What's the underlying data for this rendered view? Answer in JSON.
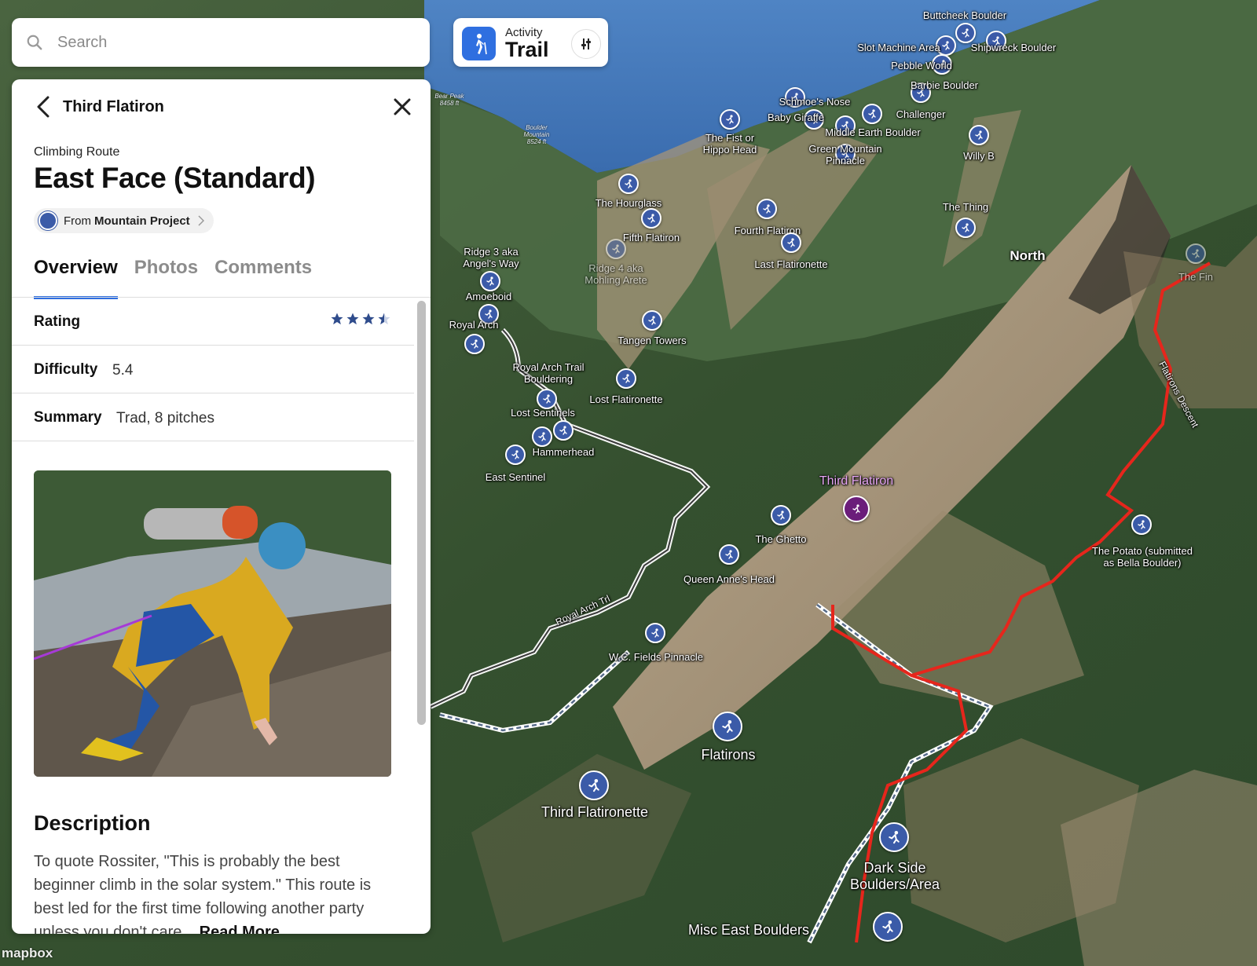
{
  "search": {
    "placeholder": "Search"
  },
  "activity": {
    "label": "Activity",
    "value": "Trail"
  },
  "panel": {
    "header_title": "Third Flatiron",
    "type": "Climbing Route",
    "name": "East Face (Standard)",
    "source_prefix": "From",
    "source_name": "Mountain Project",
    "tabs": [
      "Overview",
      "Photos",
      "Comments"
    ],
    "active_tab": "Overview",
    "rating": {
      "label": "Rating",
      "stars": 3.5,
      "max": 4
    },
    "difficulty": {
      "label": "Difficulty",
      "value": "5.4"
    },
    "summary": {
      "label": "Summary",
      "value": "Trad, 8 pitches"
    },
    "description_heading": "Description",
    "description_text": "To quote Rossiter, \"This is probably the best beginner climb in the solar system.\" This route is best led for the first time following another party unless you don't care...",
    "read_more": "Read More"
  },
  "map": {
    "markers": [
      {
        "label": "Buttcheek Boulder"
      },
      {
        "label": "Slot Machine Area"
      },
      {
        "label": "Shipwreck Boulder"
      },
      {
        "label": "Pebble World"
      },
      {
        "label": "Barbie Boulder"
      },
      {
        "label": "Schmoe's Nose"
      },
      {
        "label": "Baby Giraffe"
      },
      {
        "label": "Challenger"
      },
      {
        "label": "Middle Earth Boulder"
      },
      {
        "label": "The Fist or\nHippo Head"
      },
      {
        "label": "Green Mountain\nPinnacle"
      },
      {
        "label": "Willy B"
      },
      {
        "label": "The Hourglass"
      },
      {
        "label": "Fifth Flatiron"
      },
      {
        "label": "Ridge 4 aka\nMohling Arete"
      },
      {
        "label": "Fourth Flatiron"
      },
      {
        "label": "Last Flatironette"
      },
      {
        "label": "The Thing"
      },
      {
        "label": "Ridge 3 aka\nAngel's Way"
      },
      {
        "label": "Amoeboid"
      },
      {
        "label": "Royal Arch"
      },
      {
        "label": "Tangen Towers"
      },
      {
        "label": "Royal Arch Trail\nBouldering"
      },
      {
        "label": "Lost Flatironette"
      },
      {
        "label": "Lost Sentinels"
      },
      {
        "label": "Hammerhead"
      },
      {
        "label": "East Sentinel"
      },
      {
        "label": "Third Flatiron"
      },
      {
        "label": "The Ghetto"
      },
      {
        "label": "Queen Anne's Head"
      },
      {
        "label": "The Potato (submitted\nas Bella Boulder)"
      },
      {
        "label": "W.C. Fields Pinnacle"
      },
      {
        "label": "Flatirons"
      },
      {
        "label": "Third Flatironette"
      },
      {
        "label": "Dark Side\nBoulders/Area"
      },
      {
        "label": "Misc East Boulders"
      },
      {
        "label": "The Fin"
      }
    ],
    "area_label": "North",
    "trail_labels": [
      "Royal Arch Trl",
      "Flatirons Descent"
    ],
    "peaks": [
      {
        "label": "Bear Peak\n8458 ft"
      },
      {
        "label": "Boulder\nMountain\n8524 ft"
      }
    ],
    "attribution": "mapbox"
  }
}
